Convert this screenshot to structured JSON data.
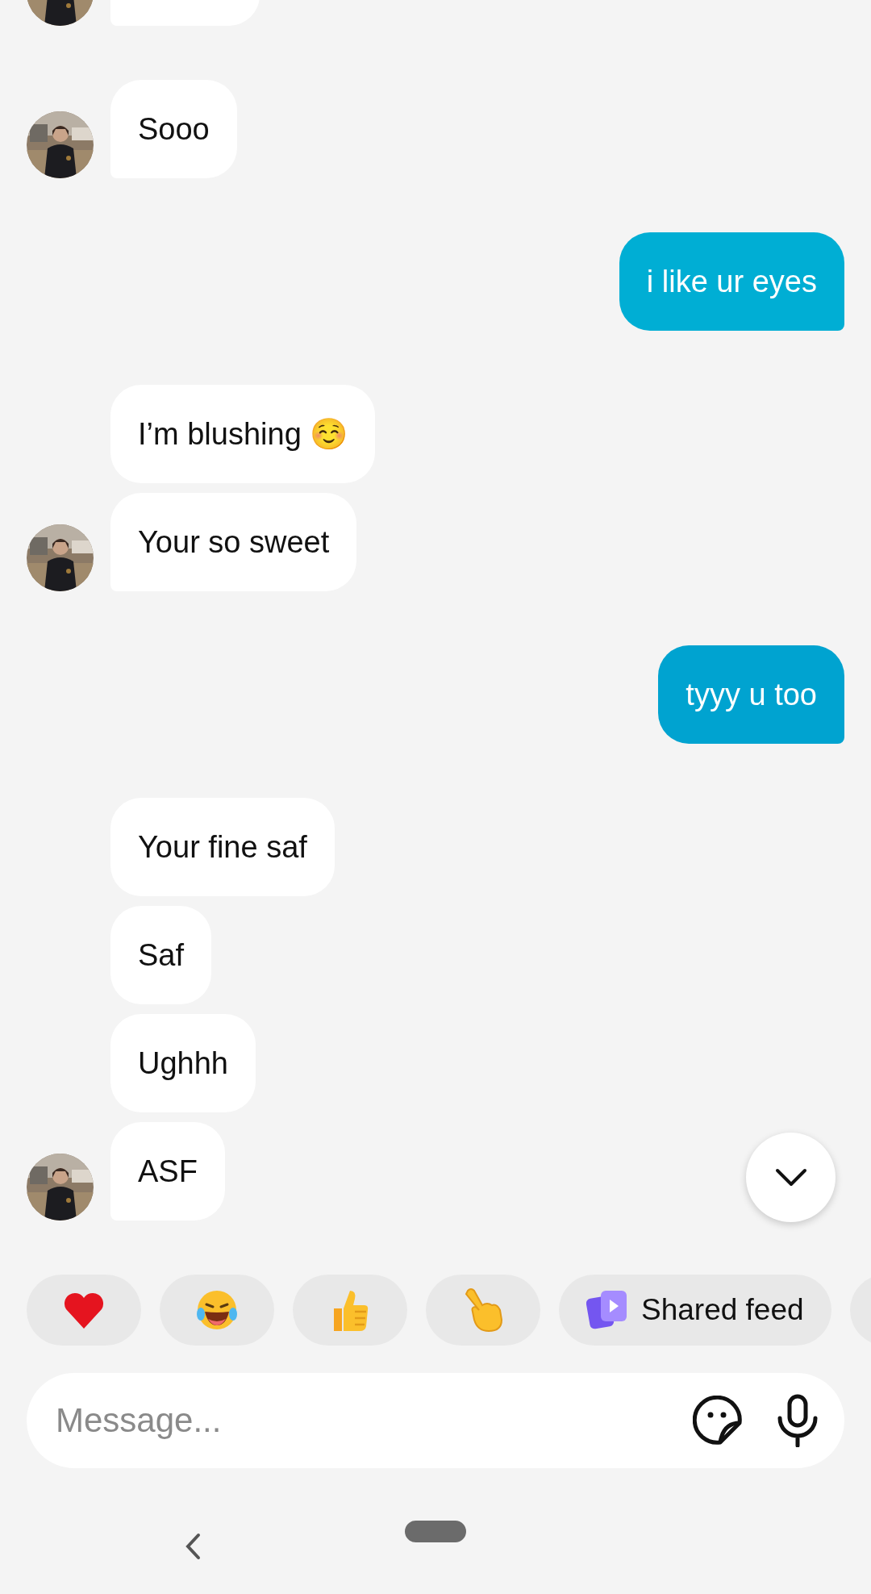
{
  "messages": [
    {
      "kind": "clipped",
      "outgoing": false,
      "avatar": true,
      "group_start": true
    },
    {
      "kind": "text",
      "text": "Sooo",
      "outgoing": false,
      "avatar": true,
      "group_start": true
    },
    {
      "kind": "text",
      "text": "i like ur eyes",
      "outgoing": true,
      "avatar": false,
      "group_start": true
    },
    {
      "kind": "text",
      "text": "I’m blushing ☺️",
      "outgoing": false,
      "avatar": false,
      "group_start": true
    },
    {
      "kind": "text",
      "text": "Your so sweet",
      "outgoing": false,
      "avatar": true,
      "group_start": false
    },
    {
      "kind": "text",
      "text": "tyyy u too",
      "outgoing": true,
      "avatar": false,
      "group_start": true
    },
    {
      "kind": "text",
      "text": "Your fine saf",
      "outgoing": false,
      "avatar": false,
      "group_start": true
    },
    {
      "kind": "text",
      "text": "Saf",
      "outgoing": false,
      "avatar": false,
      "group_start": false
    },
    {
      "kind": "text",
      "text": "Ughhh",
      "outgoing": false,
      "avatar": false,
      "group_start": false
    },
    {
      "kind": "text",
      "text": "ASF",
      "outgoing": false,
      "avatar": true,
      "group_start": false
    }
  ],
  "reactions": [
    {
      "kind": "heart"
    },
    {
      "kind": "laughing"
    },
    {
      "kind": "thumbs"
    },
    {
      "kind": "pointing"
    },
    {
      "kind": "shared",
      "label": "Shared feed"
    },
    {
      "kind": "clipped"
    }
  ],
  "composer": {
    "placeholder": "Message..."
  }
}
